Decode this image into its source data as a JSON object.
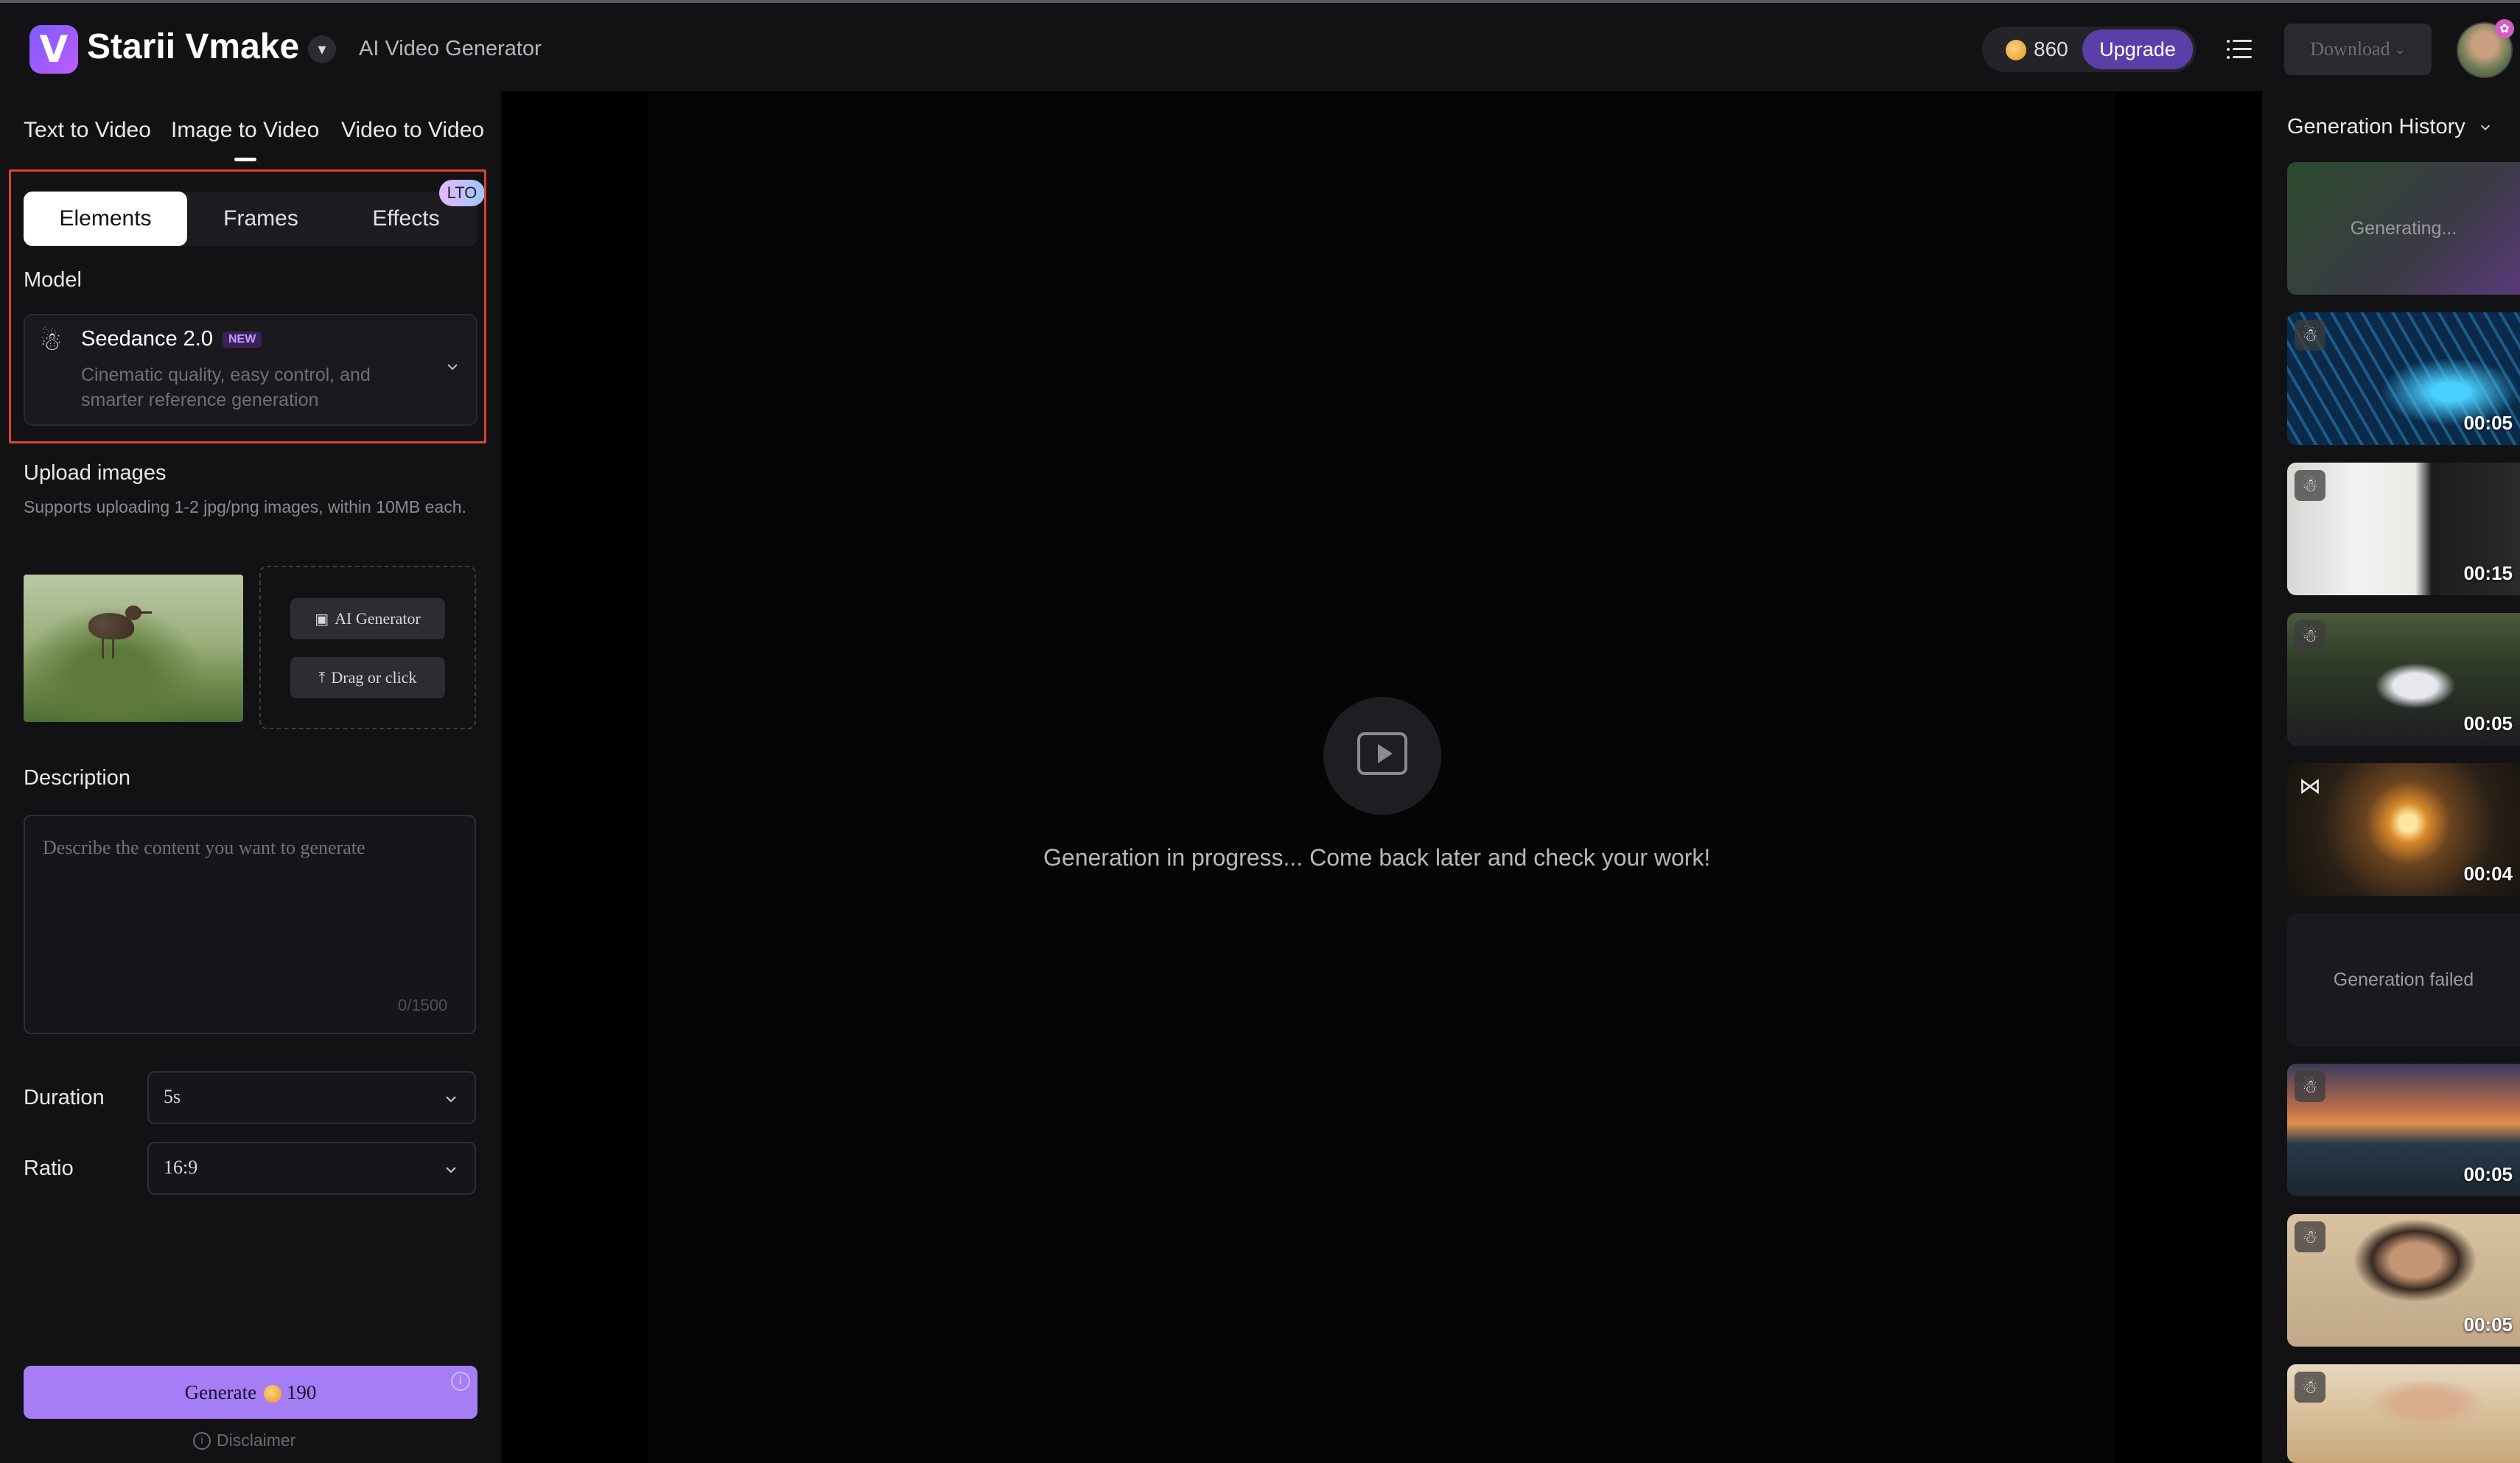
{
  "header": {
    "brand": "Starii Vmake",
    "logo_letter": "V",
    "subtitle": "AI Video Generator",
    "credits": "860",
    "upgrade_label": "Upgrade",
    "download_label": "Download"
  },
  "tabs": {
    "text_to_video": "Text to Video",
    "image_to_video": "Image to Video",
    "video_to_video": "Video to Video",
    "active": "Image to Video"
  },
  "subtabs": {
    "elements": "Elements",
    "frames": "Frames",
    "effects": "Effects",
    "lto_badge": "LTO",
    "active": "Elements"
  },
  "model": {
    "label": "Model",
    "name": "Seedance 2.0",
    "badge": "NEW",
    "description": "Cinematic quality, easy control, and smarter reference generation"
  },
  "upload": {
    "label": "Upload images",
    "hint": "Supports uploading 1-2 jpg/png images, within 10MB each.",
    "ai_generator_label": "AI Generator",
    "drag_label": "Drag or click"
  },
  "description": {
    "label": "Description",
    "placeholder": "Describe the content you want to generate",
    "count": "0/1500"
  },
  "duration": {
    "label": "Duration",
    "value": "5s"
  },
  "ratio": {
    "label": "Ratio",
    "value": "16:9"
  },
  "generate": {
    "label": "Generate",
    "cost": "190",
    "disclaimer": "Disclaimer"
  },
  "center": {
    "message": "Generation in progress... Come back later and check your work!"
  },
  "history": {
    "title": "Generation History",
    "items": [
      {
        "status": "Generating..."
      },
      {
        "duration": "00:05",
        "icon": "seedance-icon"
      },
      {
        "duration": "00:15",
        "icon": "seedance-icon"
      },
      {
        "duration": "00:05",
        "icon": "seedance-icon"
      },
      {
        "duration": "00:04",
        "icon": "meta-icon"
      },
      {
        "status": "Generation failed"
      },
      {
        "duration": "00:05",
        "icon": "seedance-icon"
      },
      {
        "duration": "00:05",
        "icon": "seedance-icon"
      },
      {
        "icon": "seedance-icon"
      }
    ]
  },
  "colors": {
    "accent": "#a57ef5",
    "upgrade": "#5b3ea8",
    "highlight_border": "#e0402c",
    "panel_bg": "#121214"
  }
}
